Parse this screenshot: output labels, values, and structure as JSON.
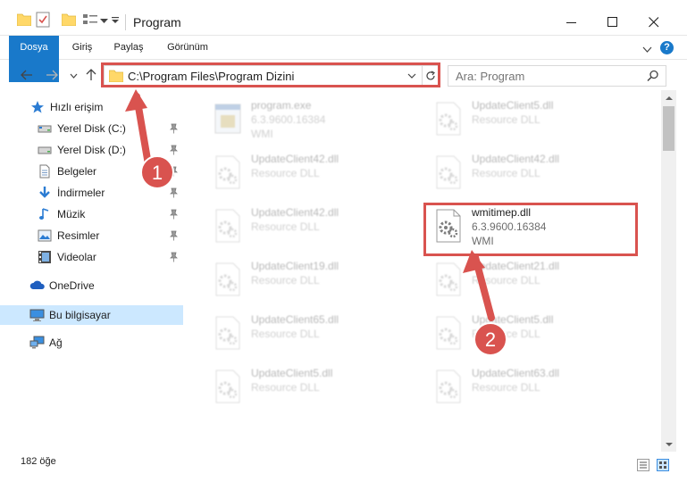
{
  "window": {
    "title": "Program"
  },
  "ribbon": {
    "tabs": [
      "Dosya",
      "Giriş",
      "Paylaş",
      "Görünüm"
    ],
    "help": "?"
  },
  "address": {
    "path": "C:\\Program Files\\Program Dizini"
  },
  "search": {
    "placeholder": "Ara: Program"
  },
  "sidebar": {
    "items": [
      {
        "label": "Hızlı erişim",
        "icon": "star-icon"
      },
      {
        "label": "Yerel Disk (C:)",
        "icon": "drive-icon",
        "pinned": true
      },
      {
        "label": "Yerel Disk (D:)",
        "icon": "drive-icon",
        "pinned": true
      },
      {
        "label": "Belgeler",
        "icon": "documents-icon",
        "pinned": true
      },
      {
        "label": "İndirmeler",
        "icon": "download-icon",
        "pinned": true
      },
      {
        "label": "Müzik",
        "icon": "music-icon",
        "pinned": true
      },
      {
        "label": "Resimler",
        "icon": "pictures-icon",
        "pinned": true
      },
      {
        "label": "Videolar",
        "icon": "video-icon",
        "pinned": true
      },
      {
        "label": "OneDrive",
        "icon": "cloud-icon"
      },
      {
        "label": "Bu bilgisayar",
        "icon": "computer-icon",
        "selected": true
      },
      {
        "label": "Ağ",
        "icon": "network-icon"
      }
    ]
  },
  "files": [
    {
      "name": "program.exe",
      "line2": "6.3.9600.16384",
      "line3": "WMI"
    },
    {
      "name": "UpdateClient5.dll",
      "line2": "Resource DLL"
    },
    {
      "name": "UpdateClient42.dll",
      "line2": "Resource DLL"
    },
    {
      "name": "UpdateClient42.dll",
      "line2": "Resource DLL"
    },
    {
      "name": "UpdateClient42.dll",
      "line2": "Resource DLL"
    },
    {
      "name": "wmitimep.dll",
      "line2": "6.3.9600.16384",
      "line3": "WMI"
    },
    {
      "name": "UpdateClient19.dll",
      "line2": "Resource DLL"
    },
    {
      "name": "UpdateClient21.dll",
      "line2": "Resource DLL"
    },
    {
      "name": "UpdateClient65.dll",
      "line2": "Resource DLL"
    },
    {
      "name": "UpdateClient5.dll",
      "line2": "Resource DLL"
    },
    {
      "name": "UpdateClient5.dll",
      "line2": "Resource DLL"
    },
    {
      "name": "UpdateClient63.dll",
      "line2": "Resource DLL"
    }
  ],
  "status": {
    "count": "182 öğe"
  },
  "annotations": {
    "step1": "1",
    "step2": "2",
    "color": "#d9534f"
  },
  "colors": {
    "accent": "#1979ca",
    "selected": "#cce8ff"
  }
}
